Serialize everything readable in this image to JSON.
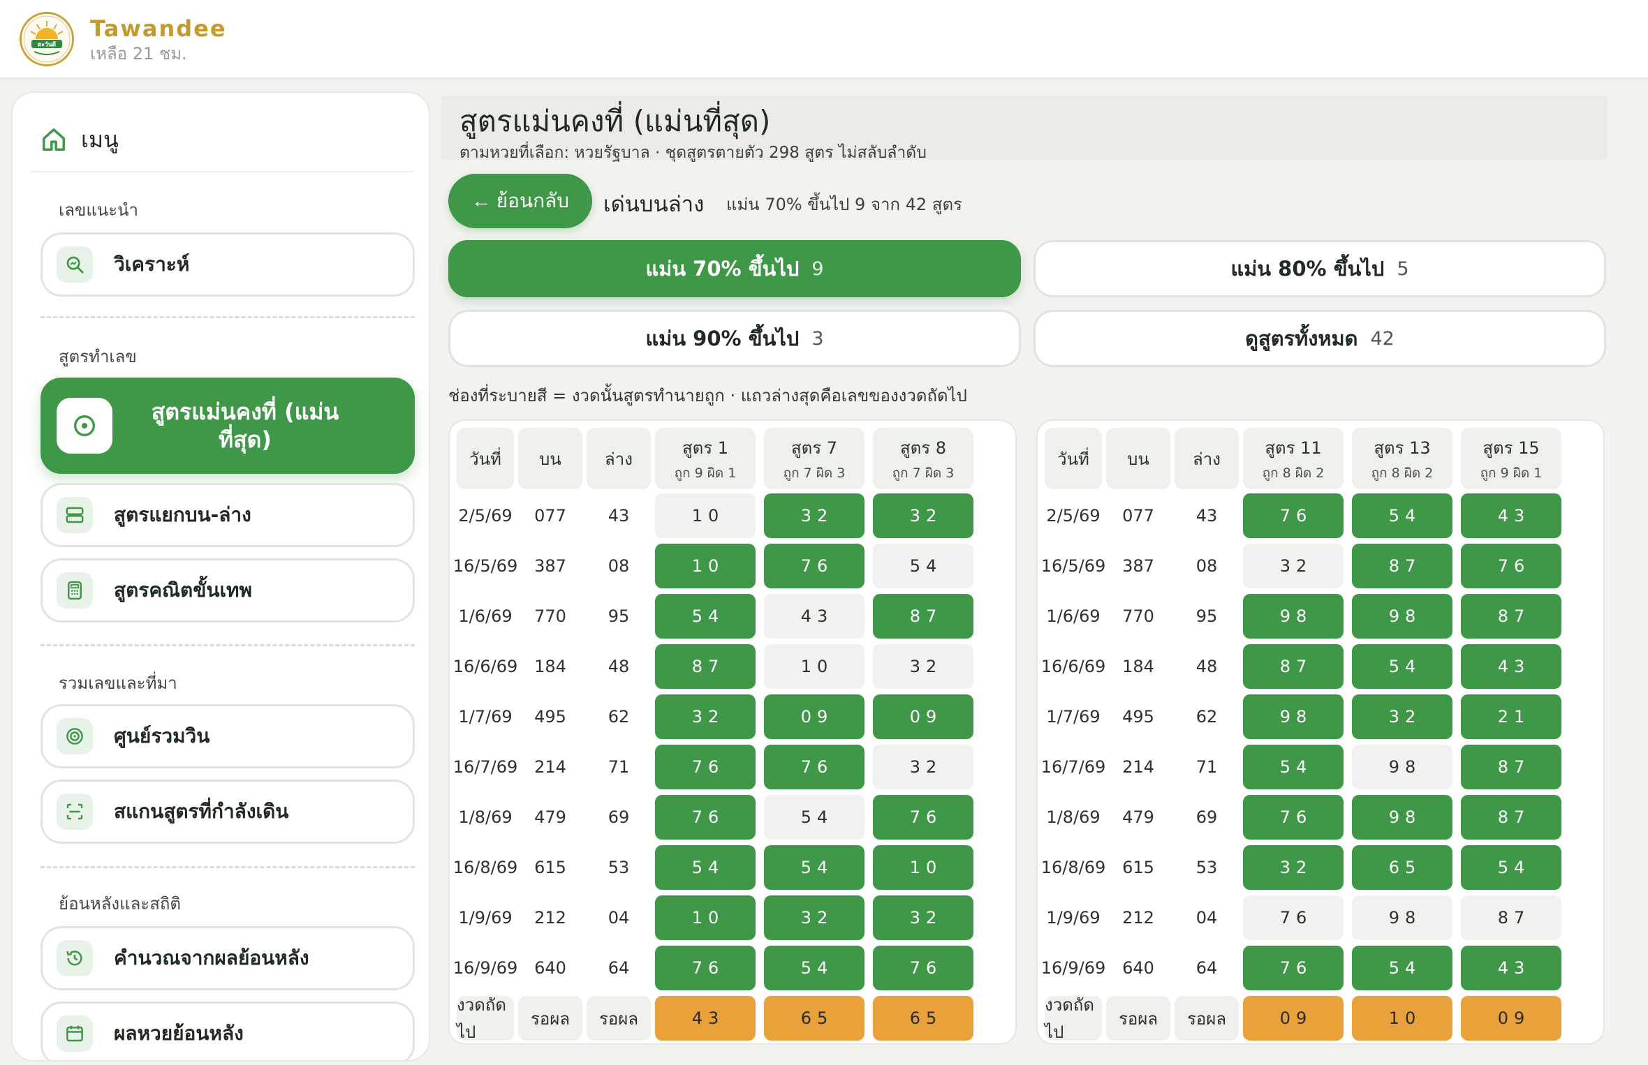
{
  "header": {
    "brand": "Tawandee",
    "subtitle": "เหลือ 21 ชม.",
    "logo_text": "ตะวันดี",
    "colors": {
      "brand_gold": "#c49a2a",
      "accent_green": "#3f9748",
      "next_orange": "#e9a23b"
    }
  },
  "sidebar": {
    "menu_label": "เมนู",
    "menu_icon": "home-icon",
    "sections": [
      {
        "title": "เลขแนะนำ",
        "items": [
          {
            "label": "วิเคราะห์",
            "icon": "analyze-icon"
          }
        ]
      },
      {
        "title": "สูตรทำเลข",
        "items": [
          {
            "label": "สูตรแม่นคงที่ (แม่นที่สุด)",
            "icon": "target-icon",
            "active": true
          },
          {
            "label": "สูตรแยกบน-ล่าง",
            "icon": "split-icon"
          },
          {
            "label": "สูตรคณิตขั้นเทพ",
            "icon": "calculator-icon"
          }
        ]
      },
      {
        "title": "รวมเลขและที่มา",
        "items": [
          {
            "label": "ศูนย์รวมวิน",
            "icon": "bullseye-icon"
          },
          {
            "label": "สแกนสูตรที่กำลังเดิน",
            "icon": "scan-icon"
          }
        ]
      },
      {
        "title": "ย้อนหลังและสถิติ",
        "items": [
          {
            "label": "คำนวณจากผลย้อนหลัง",
            "icon": "history-icon"
          },
          {
            "label": "ผลหวยย้อนหลัง",
            "icon": "calendar-icon"
          }
        ]
      }
    ]
  },
  "main": {
    "title": "สูตรแม่นคงที่ (แม่นที่สุด)",
    "subtitle": "ตามหวยที่เลือก: หวยรัฐบาล · ชุดสูตรตายตัว 298 สูตร ไม่สลับลำดับ",
    "back_label": "← ย้อนกลับ",
    "mode_title": "เด่นบนล่าง",
    "mode_desc": "แม่น 70% ขึ้นไป 9 จาก 42 สูตร",
    "filters": [
      {
        "label": "แม่น 70% ขึ้นไป",
        "count": "9",
        "active": true
      },
      {
        "label": "แม่น 80% ขึ้นไป",
        "count": "5",
        "active": false
      },
      {
        "label": "แม่น 90% ขึ้นไป",
        "count": "3",
        "active": false
      },
      {
        "label": "ดูสูตรทั้งหมด",
        "count": "42",
        "active": false
      }
    ],
    "legend_note": "ช่องที่ระบายสี = งวดนั้นสูตรทำนายถูก · แถวล่างสุดคือเลขของงวดถัดไป",
    "tables": [
      {
        "col_date": "วันที่",
        "col_top": "บน",
        "col_bottom": "ล่าง",
        "formulas": [
          {
            "name": "สูตร 1",
            "stat": "ถูก 9 ผิด 1"
          },
          {
            "name": "สูตร 7",
            "stat": "ถูก 7 ผิด 3"
          },
          {
            "name": "สูตร 8",
            "stat": "ถูก 7 ผิด 3"
          }
        ],
        "rows": [
          {
            "date": "2/5/69",
            "top": "077",
            "bottom": "43",
            "cells": [
              [
                "10",
                false
              ],
              [
                "32",
                true
              ],
              [
                "32",
                true
              ]
            ]
          },
          {
            "date": "16/5/69",
            "top": "387",
            "bottom": "08",
            "cells": [
              [
                "10",
                true
              ],
              [
                "76",
                true
              ],
              [
                "54",
                false
              ]
            ]
          },
          {
            "date": "1/6/69",
            "top": "770",
            "bottom": "95",
            "cells": [
              [
                "54",
                true
              ],
              [
                "43",
                false
              ],
              [
                "87",
                true
              ]
            ]
          },
          {
            "date": "16/6/69",
            "top": "184",
            "bottom": "48",
            "cells": [
              [
                "87",
                true
              ],
              [
                "10",
                false
              ],
              [
                "32",
                false
              ]
            ]
          },
          {
            "date": "1/7/69",
            "top": "495",
            "bottom": "62",
            "cells": [
              [
                "32",
                true
              ],
              [
                "09",
                true
              ],
              [
                "09",
                true
              ]
            ]
          },
          {
            "date": "16/7/69",
            "top": "214",
            "bottom": "71",
            "cells": [
              [
                "76",
                true
              ],
              [
                "76",
                true
              ],
              [
                "32",
                false
              ]
            ]
          },
          {
            "date": "1/8/69",
            "top": "479",
            "bottom": "69",
            "cells": [
              [
                "76",
                true
              ],
              [
                "54",
                false
              ],
              [
                "76",
                true
              ]
            ]
          },
          {
            "date": "16/8/69",
            "top": "615",
            "bottom": "53",
            "cells": [
              [
                "54",
                true
              ],
              [
                "54",
                true
              ],
              [
                "10",
                true
              ]
            ]
          },
          {
            "date": "1/9/69",
            "top": "212",
            "bottom": "04",
            "cells": [
              [
                "10",
                true
              ],
              [
                "32",
                true
              ],
              [
                "32",
                true
              ]
            ]
          },
          {
            "date": "16/9/69",
            "top": "640",
            "bottom": "64",
            "cells": [
              [
                "76",
                true
              ],
              [
                "54",
                true
              ],
              [
                "76",
                true
              ]
            ]
          }
        ],
        "next": {
          "label": "งวดถัดไป",
          "top": "รอผล",
          "bottom": "รอผล",
          "cells": [
            "43",
            "65",
            "65"
          ]
        }
      },
      {
        "col_date": "วันที่",
        "col_top": "บน",
        "col_bottom": "ล่าง",
        "formulas": [
          {
            "name": "สูตร 11",
            "stat": "ถูก 8 ผิด 2"
          },
          {
            "name": "สูตร 13",
            "stat": "ถูก 8 ผิด 2"
          },
          {
            "name": "สูตร 15",
            "stat": "ถูก 9 ผิด 1"
          }
        ],
        "rows": [
          {
            "date": "2/5/69",
            "top": "077",
            "bottom": "43",
            "cells": [
              [
                "76",
                true
              ],
              [
                "54",
                true
              ],
              [
                "43",
                true
              ]
            ]
          },
          {
            "date": "16/5/69",
            "top": "387",
            "bottom": "08",
            "cells": [
              [
                "32",
                false
              ],
              [
                "87",
                true
              ],
              [
                "76",
                true
              ]
            ]
          },
          {
            "date": "1/6/69",
            "top": "770",
            "bottom": "95",
            "cells": [
              [
                "98",
                true
              ],
              [
                "98",
                true
              ],
              [
                "87",
                true
              ]
            ]
          },
          {
            "date": "16/6/69",
            "top": "184",
            "bottom": "48",
            "cells": [
              [
                "87",
                true
              ],
              [
                "54",
                true
              ],
              [
                "43",
                true
              ]
            ]
          },
          {
            "date": "1/7/69",
            "top": "495",
            "bottom": "62",
            "cells": [
              [
                "98",
                true
              ],
              [
                "32",
                true
              ],
              [
                "21",
                true
              ]
            ]
          },
          {
            "date": "16/7/69",
            "top": "214",
            "bottom": "71",
            "cells": [
              [
                "54",
                true
              ],
              [
                "98",
                false
              ],
              [
                "87",
                true
              ]
            ]
          },
          {
            "date": "1/8/69",
            "top": "479",
            "bottom": "69",
            "cells": [
              [
                "76",
                true
              ],
              [
                "98",
                true
              ],
              [
                "87",
                true
              ]
            ]
          },
          {
            "date": "16/8/69",
            "top": "615",
            "bottom": "53",
            "cells": [
              [
                "32",
                true
              ],
              [
                "65",
                true
              ],
              [
                "54",
                true
              ]
            ]
          },
          {
            "date": "1/9/69",
            "top": "212",
            "bottom": "04",
            "cells": [
              [
                "76",
                false
              ],
              [
                "98",
                false
              ],
              [
                "87",
                false
              ]
            ]
          },
          {
            "date": "16/9/69",
            "top": "640",
            "bottom": "64",
            "cells": [
              [
                "76",
                true
              ],
              [
                "54",
                true
              ],
              [
                "43",
                true
              ]
            ]
          }
        ],
        "next": {
          "label": "งวดถัดไป",
          "top": "รอผล",
          "bottom": "รอผล",
          "cells": [
            "09",
            "10",
            "09"
          ]
        }
      }
    ]
  }
}
